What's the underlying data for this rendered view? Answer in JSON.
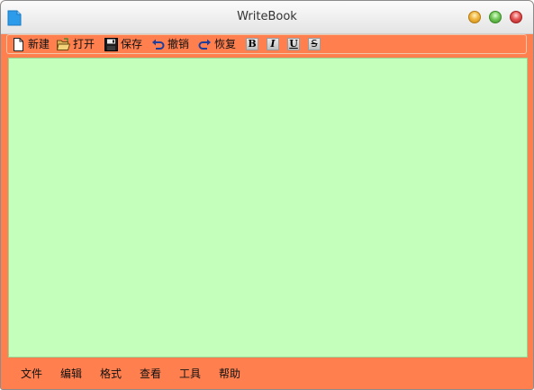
{
  "window": {
    "title": "WriteBook"
  },
  "toolbar": {
    "new_label": "新建",
    "open_label": "打开",
    "save_label": "保存",
    "undo_label": "撤销",
    "redo_label": "恢复",
    "bold": "B",
    "italic": "I",
    "underline": "U",
    "strike": "S"
  },
  "editor": {
    "content": ""
  },
  "menubar": {
    "items": [
      "文件",
      "编辑",
      "格式",
      "查看",
      "工具",
      "帮助"
    ]
  },
  "colors": {
    "accent": "#ff7f4f",
    "editor_bg": "#c4ffbc"
  },
  "icons": [
    "document-icon",
    "new-file-icon",
    "open-folder-icon",
    "save-disk-icon",
    "undo-icon",
    "redo-icon",
    "minimize-icon",
    "maximize-icon",
    "close-icon"
  ]
}
